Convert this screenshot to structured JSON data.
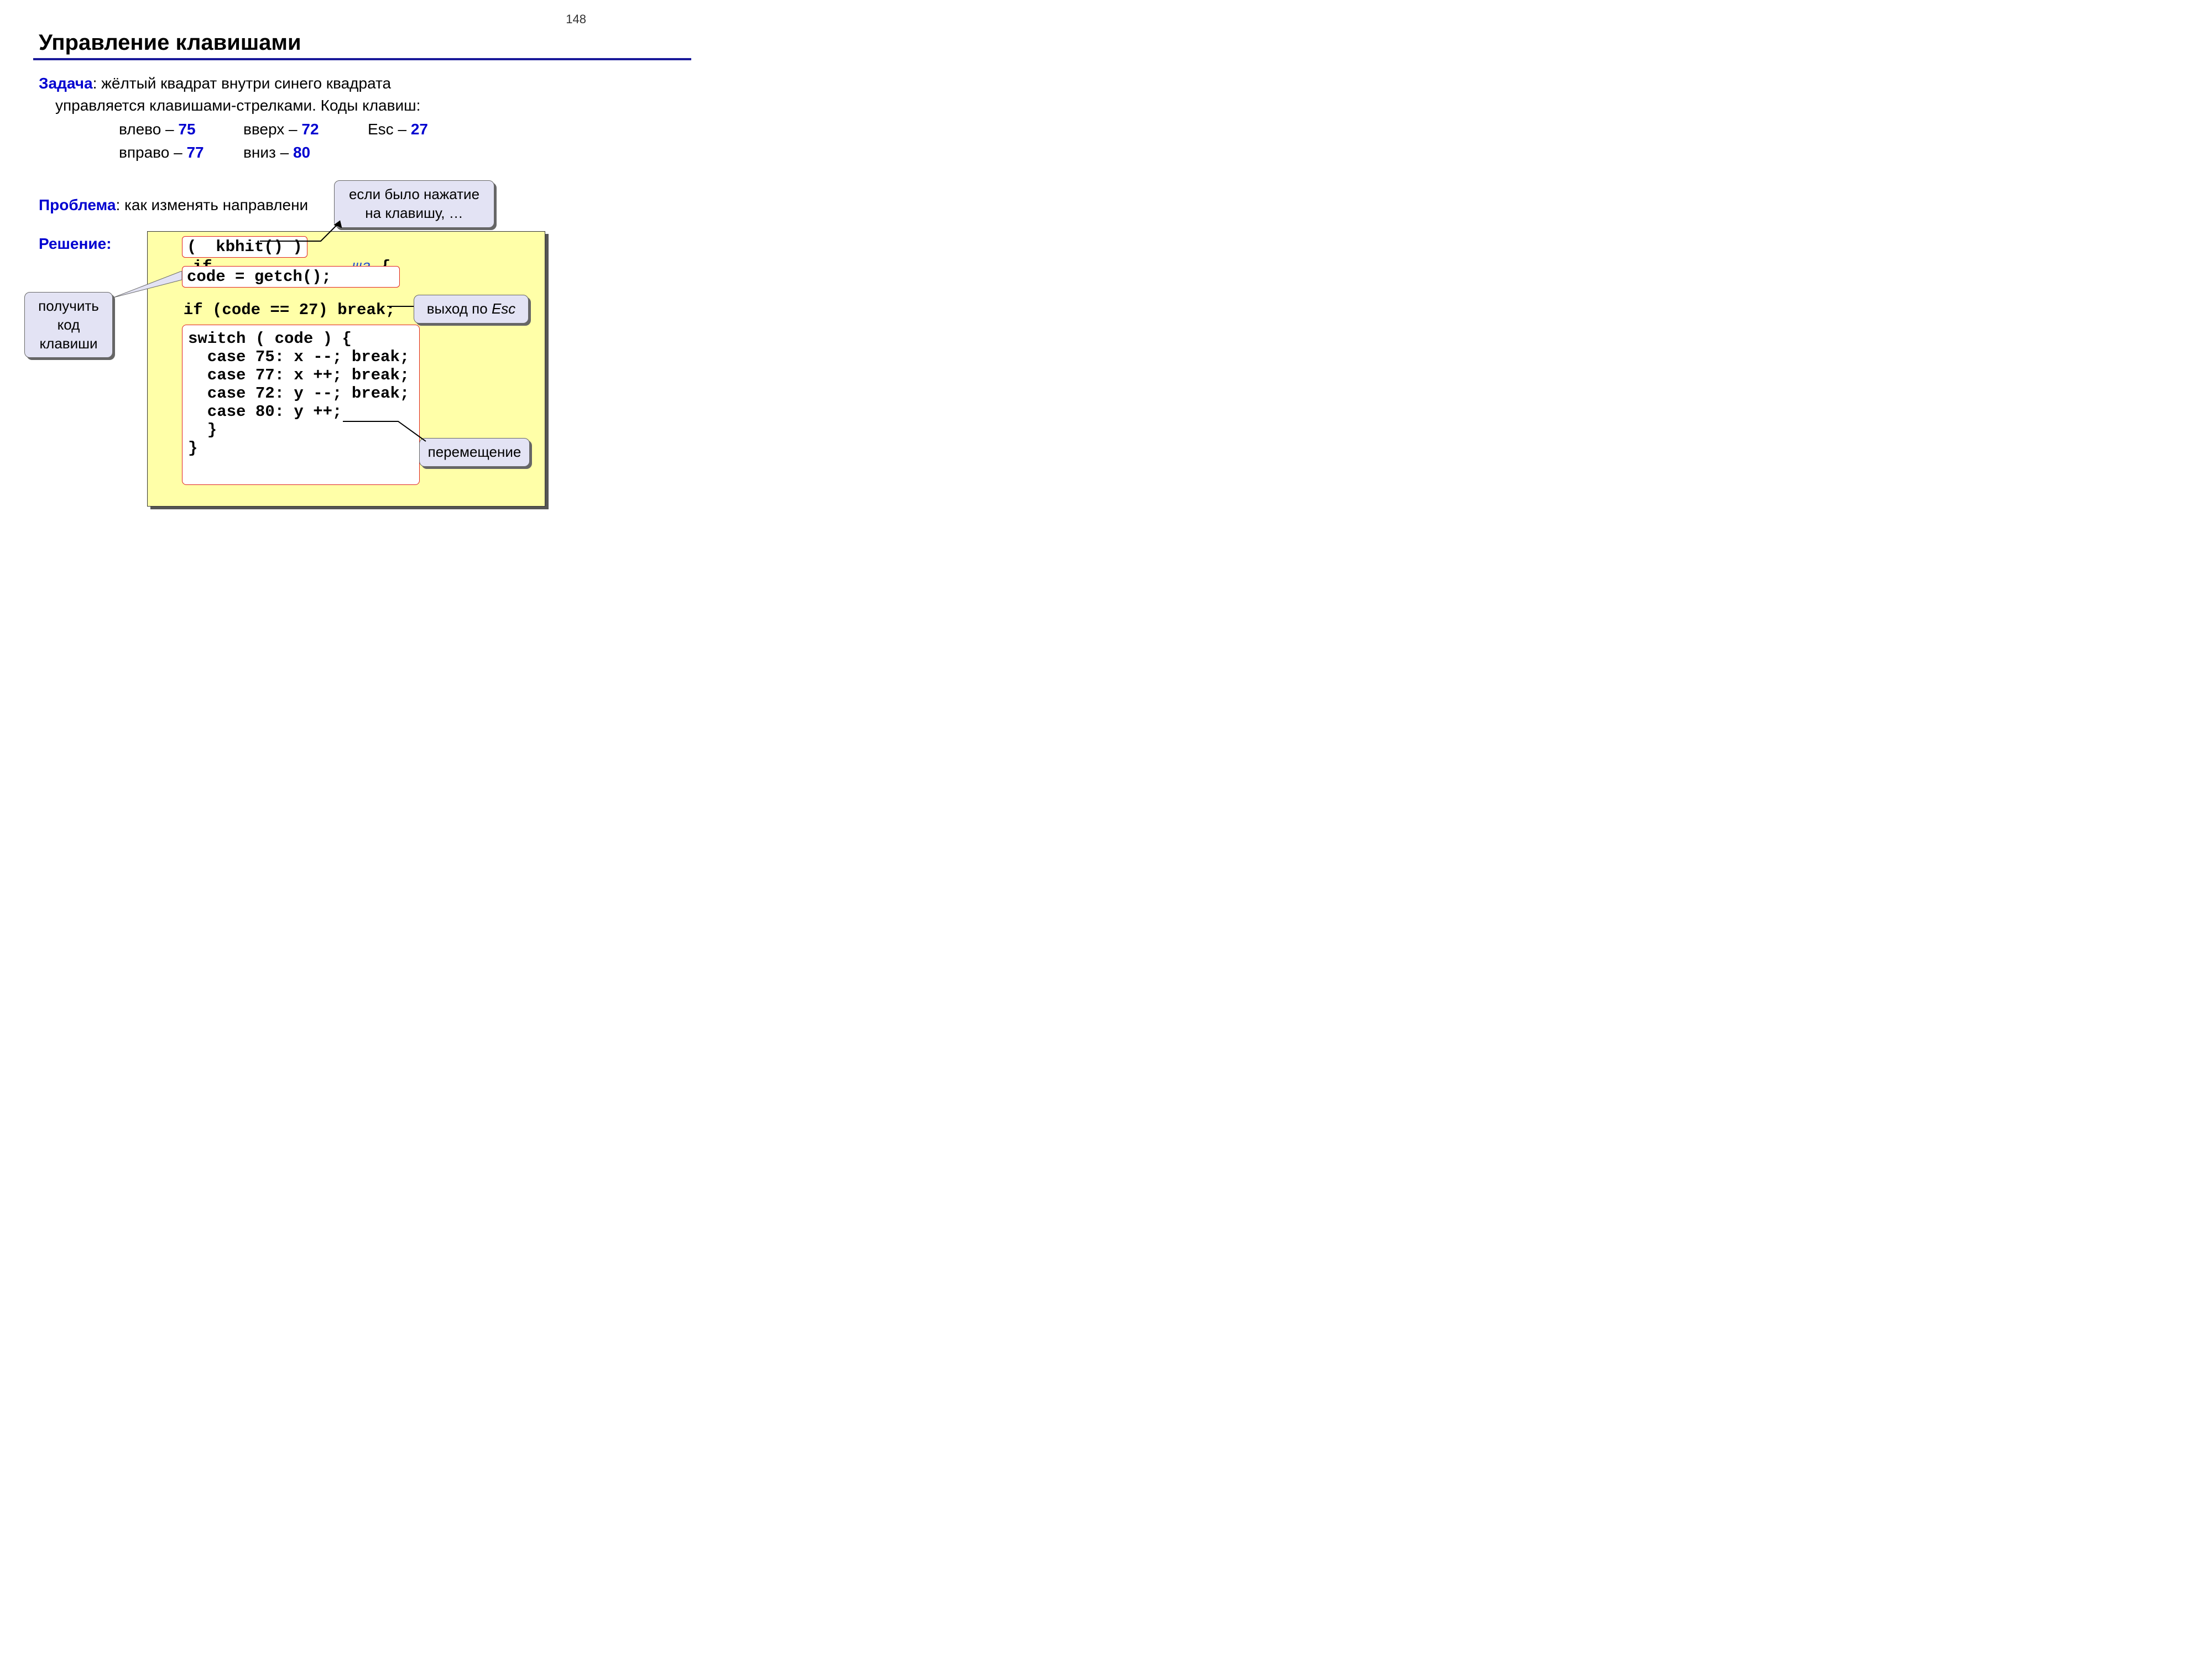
{
  "page_number": "148",
  "title": "Управление клавишами",
  "task_label": "Задача",
  "task_line1": ": жёлтый квадрат внутри синего квадрата",
  "task_line2": "управляется клавишами-стрелками. Коды клавиш:",
  "keycodes": {
    "left_label": "влево – ",
    "left_code": "75",
    "up_label": "вверх – ",
    "up_code": "72",
    "esc_label": "Esc – ",
    "esc_code": "27",
    "right_label": "вправо – ",
    "right_code": "77",
    "down_label": "вниз – ",
    "down_code": "80"
  },
  "problem_label": "Проблема",
  "problem_text": ": как изменять направлени",
  "solution_label": "Решение:",
  "code": {
    "if_keyword": "if ",
    "kbhit_box": "(  kbhit() )",
    "italic_tail": "ша",
    "open_brace": " {",
    "getch_box": "code = getch();",
    "escline": "  if (code == 27) break;",
    "switch_open": "switch ( code ) {",
    "case75": "  case 75: x --; break;",
    "case77": "  case 77: x ++; break;",
    "case72": "  case 72: y --; break;",
    "case80": "  case 80: y ++;",
    "close_inner": "  }",
    "close_outer": "}"
  },
  "callouts": {
    "kbhit": "если было нажатие на клавишу, …",
    "getch": "получить код клавиши",
    "esc": "выход по ",
    "esc_italic": "Esc",
    "move": "перемещение"
  }
}
